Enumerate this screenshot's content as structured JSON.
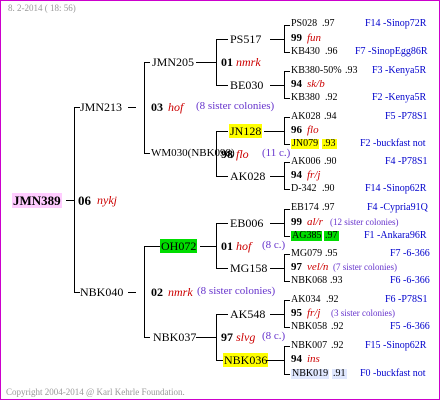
{
  "header": {
    "date": "8. 2-2014 ( 18: 56)"
  },
  "root": {
    "id": "JMN389",
    "year": "06",
    "breed": "nykj"
  },
  "gen1": {
    "top": {
      "id": "JMN213",
      "year": "03",
      "breed": "hof",
      "note": "(8 sister colonies)"
    },
    "bottom": {
      "id": "NBK040",
      "year": "02",
      "breed": "nmrk",
      "note": "(8 sister colonies)"
    }
  },
  "gen2": [
    {
      "id": "JMN205",
      "year": "01",
      "breed": "nmrk"
    },
    {
      "id": "WM030(NBK098)",
      "year": "98",
      "breed": "flo",
      "note": "(11 c.)"
    },
    {
      "id": "OH072",
      "year": "01",
      "breed": "hof",
      "note": "(8 c.)"
    },
    {
      "id": "NBK037",
      "year": "97",
      "breed": "slvg",
      "note": "(8 c.)"
    }
  ],
  "gen3": [
    {
      "id": "PS517",
      "year": "99",
      "breed": "fun"
    },
    {
      "id": "BE030",
      "year": "94",
      "breed": "sk/b"
    },
    {
      "id": "JN128",
      "year": "96",
      "breed": "flo"
    },
    {
      "id": "AK028",
      "year": "94",
      "breed": "fr/j"
    },
    {
      "id": "EB006",
      "year": "99",
      "breed": "al/r",
      "note": "(12 sister colonies)"
    },
    {
      "id": "MG158",
      "year": "97",
      "breed": "vel/n",
      "note": "(7 sister colonies)"
    },
    {
      "id": "AK548",
      "year": "95",
      "breed": "fr/j",
      "note": "(3 sister colonies)"
    },
    {
      "id": "NBK036",
      "year": "94",
      "breed": "ins"
    }
  ],
  "gen4": [
    {
      "id": "PS028",
      "val": ".97",
      "src": "F14 -Sinop72R"
    },
    {
      "id": "KB430",
      "val": ".96",
      "src": "F7 -SinopEgg86R"
    },
    {
      "id": "KB380-50%",
      "val": ".93",
      "src": "F3 -Kenya5R"
    },
    {
      "id": "KB380",
      "val": ".92",
      "src": "F2 -Kenya5R"
    },
    {
      "id": "AK028",
      "val": ".94",
      "src": "F5 -P78S1"
    },
    {
      "id": "JN079",
      "val": ".93",
      "src": "F2 -buckfast not"
    },
    {
      "id": "AK006",
      "val": ".90",
      "src": "F4 -P78S1"
    },
    {
      "id": "D-342",
      "val": ".90",
      "src": "F14 -Sinop62R"
    },
    {
      "id": "EB174",
      "val": ".97",
      "src": "F4 -Cypria91Q"
    },
    {
      "id": "AG385",
      "val": ".97",
      "src": "F1 -Ankara96R"
    },
    {
      "id": "MG079",
      "val": ".95",
      "src": "F7 -6-366"
    },
    {
      "id": "NBK068",
      "val": ".93",
      "src": "F6 -6-366"
    },
    {
      "id": "AK034",
      "val": ".92",
      "src": "F6 -P78S1"
    },
    {
      "id": "NBK058",
      "val": ".92",
      "src": "F5 -6-366"
    },
    {
      "id": "NBK007",
      "val": ".92",
      "src": "F15 -Sinop62R"
    },
    {
      "id": "NBK019",
      "val": ".91",
      "src": "F0 -buckfast not"
    }
  ],
  "footer": {
    "copyright": "Copyright 2004-2014 @ Karl Kehrle Foundation."
  }
}
